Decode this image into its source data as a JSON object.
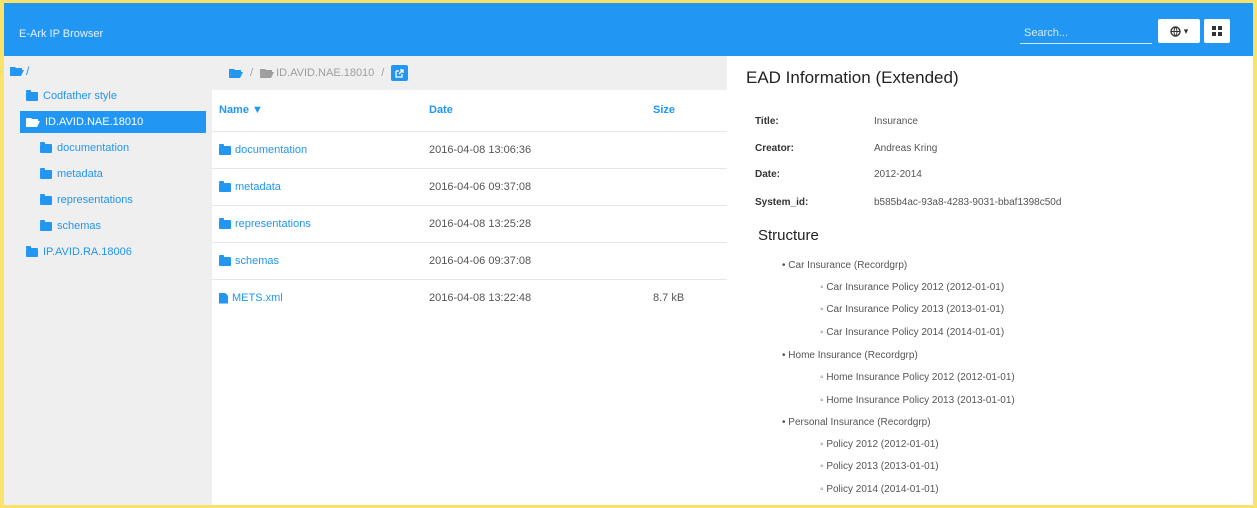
{
  "app": {
    "title": "E-Ark IP Browser"
  },
  "search": {
    "placeholder": "Search..."
  },
  "toolbar": {
    "globe_caret": "▾"
  },
  "sidebar": {
    "root_label": "/",
    "items": [
      {
        "label": "Codfather style",
        "level": 1,
        "selected": false
      },
      {
        "label": "ID.AVID.NAE.18010",
        "level": 1,
        "selected": true
      },
      {
        "label": "documentation",
        "level": 2,
        "selected": false
      },
      {
        "label": "metadata",
        "level": 2,
        "selected": false
      },
      {
        "label": "representations",
        "level": 2,
        "selected": false
      },
      {
        "label": "schemas",
        "level": 2,
        "selected": false
      },
      {
        "label": "IP.AVID.RA.18006",
        "level": 0,
        "selected": false
      }
    ]
  },
  "breadcrumb": {
    "separator": "/",
    "current": "ID.AVID.NAE.18010"
  },
  "files": {
    "headers": {
      "name": "Name ▼",
      "date": "Date",
      "size": "Size"
    },
    "rows": [
      {
        "name": "documentation",
        "type": "folder",
        "date": "2016-04-08 13:06:36",
        "size": ""
      },
      {
        "name": "metadata",
        "type": "folder",
        "date": "2016-04-06 09:37:08",
        "size": ""
      },
      {
        "name": "representations",
        "type": "folder",
        "date": "2016-04-08 13:25:28",
        "size": ""
      },
      {
        "name": "schemas",
        "type": "folder",
        "date": "2016-04-06 09:37:08",
        "size": ""
      },
      {
        "name": "METS.xml",
        "type": "file",
        "date": "2016-04-08 13:22:48",
        "size": "8.7 kB"
      }
    ]
  },
  "ead": {
    "title": "EAD Information (Extended)",
    "fields": [
      {
        "label": "Title:",
        "value": "Insurance"
      },
      {
        "label": "Creator:",
        "value": "Andreas Kring"
      },
      {
        "label": "Date:",
        "value": "2012-2014"
      },
      {
        "label": "System_id:",
        "value": "b585b4ac-93a8-4283-9031-bbaf1398c50d"
      }
    ],
    "structure_title": "Structure",
    "structure": [
      {
        "text": "• Car Insurance (Recordgrp)",
        "level": 0
      },
      {
        "text": "◦ Car Insurance Policy 2012 (2012-01-01)",
        "level": 1
      },
      {
        "text": "◦ Car Insurance Policy 2013 (2013-01-01)",
        "level": 1
      },
      {
        "text": "◦ Car Insurance Policy 2014 (2014-01-01)",
        "level": 1
      },
      {
        "text": "• Home Insurance (Recordgrp)",
        "level": 0
      },
      {
        "text": "◦ Home Insurance Policy 2012 (2012-01-01)",
        "level": 1
      },
      {
        "text": "◦ Home Insurance Policy 2013 (2013-01-01)",
        "level": 1
      },
      {
        "text": "• Personal Insurance (Recordgrp)",
        "level": 0
      },
      {
        "text": "◦ Policy 2012 (2012-01-01)",
        "level": 1
      },
      {
        "text": "◦ Policy 2013 (2013-01-01)",
        "level": 1
      },
      {
        "text": "◦ Policy 2014 (2014-01-01)",
        "level": 1
      }
    ]
  },
  "colors": {
    "accent": "#2196f3",
    "frame": "#fbe26a",
    "sidebar_bg": "#efefef"
  }
}
